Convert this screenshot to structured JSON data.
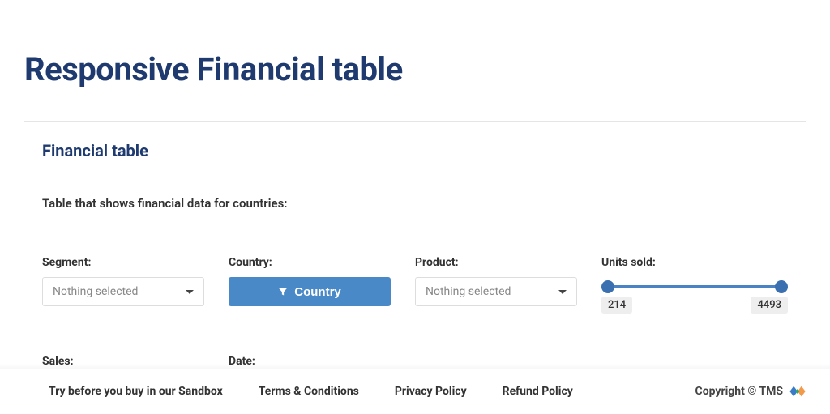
{
  "page": {
    "title": "Responsive Financial table",
    "section_title": "Financial table",
    "description": "Table that shows financial data for countries:"
  },
  "filters": {
    "segment": {
      "label": "Segment:",
      "placeholder": "Nothing selected"
    },
    "country": {
      "label": "Country:",
      "button_text": "Country"
    },
    "product": {
      "label": "Product:",
      "placeholder": "Nothing selected"
    },
    "units_sold": {
      "label": "Units sold:",
      "min": "214",
      "max": "4493"
    },
    "sales": {
      "label": "Sales:"
    },
    "date": {
      "label": "Date:"
    }
  },
  "footer": {
    "links": [
      "Try before you buy in our Sandbox",
      "Terms & Conditions",
      "Privacy Policy",
      "Refund Policy"
    ],
    "copyright": "Copyright © TMS"
  }
}
